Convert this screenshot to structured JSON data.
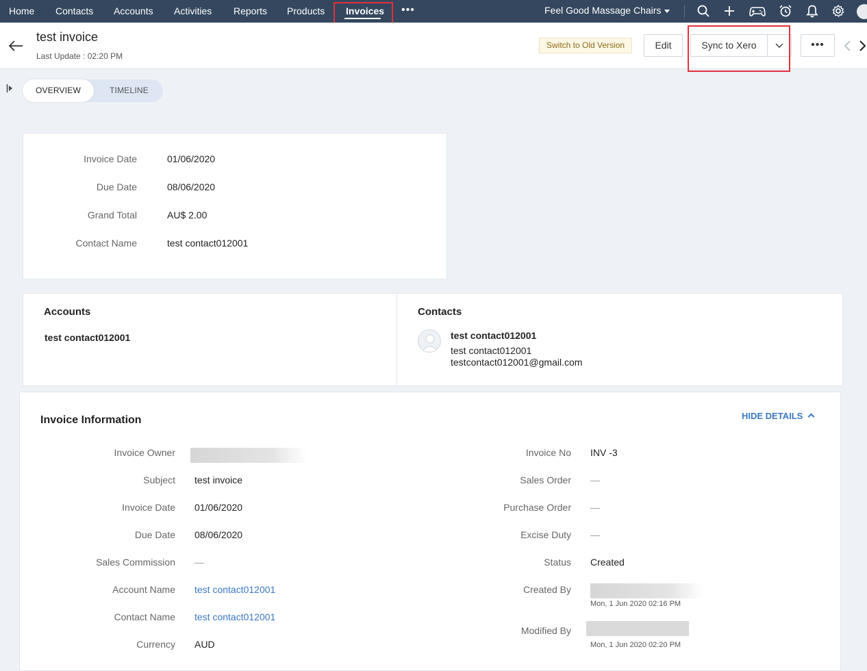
{
  "nav": {
    "items": [
      "Home",
      "Contacts",
      "Accounts",
      "Activities",
      "Reports",
      "Products",
      "Invoices"
    ],
    "active": "Invoices",
    "more": "•••",
    "org_name": "Feel Good Massage Chairs",
    "icons": [
      "search-icon",
      "plus-icon",
      "gamepad-icon",
      "alarm-icon",
      "bell-icon",
      "gear-icon",
      "avatar"
    ]
  },
  "header": {
    "title": "test invoice",
    "subtitle": "Last Update : 02:20 PM",
    "old_version": "Switch to Old Version",
    "edit": "Edit",
    "sync": "Sync to Xero",
    "more": "•••"
  },
  "tabs": [
    "OVERVIEW",
    "TIMELINE"
  ],
  "summary": {
    "rows": [
      {
        "label": "Invoice Date",
        "value": "01/06/2020"
      },
      {
        "label": "Due Date",
        "value": "08/06/2020"
      },
      {
        "label": "Grand Total",
        "value": "AU$ 2.00"
      },
      {
        "label": "Contact Name",
        "value": "test contact012001"
      }
    ]
  },
  "related": {
    "accounts_title": "Accounts",
    "account_name": "test contact012001",
    "contacts_title": "Contacts",
    "contact_name": "test contact012001",
    "contact_account": "test contact012001",
    "contact_email": "testcontact012001@gmail.com"
  },
  "info": {
    "title": "Invoice Information",
    "hide": "HIDE DETAILS",
    "left": [
      {
        "label": "Invoice Owner",
        "value": ""
      },
      {
        "label": "Subject",
        "value": "test invoice"
      },
      {
        "label": "Invoice Date",
        "value": "01/06/2020"
      },
      {
        "label": "Due Date",
        "value": "08/06/2020"
      },
      {
        "label": "Sales Commission",
        "value": "—"
      },
      {
        "label": "Account Name",
        "value": "test contact012001"
      },
      {
        "label": "Contact Name",
        "value": "test contact012001"
      },
      {
        "label": "Currency",
        "value": "AUD"
      }
    ],
    "right": [
      {
        "label": "Invoice No",
        "value": "INV -3"
      },
      {
        "label": "Sales Order",
        "value": "—"
      },
      {
        "label": "Purchase Order",
        "value": "—"
      },
      {
        "label": "Excise Duty",
        "value": "—"
      },
      {
        "label": "Status",
        "value": "Created"
      },
      {
        "label": "Created By",
        "value": "",
        "meta": "Mon, 1 Jun 2020 02:16 PM"
      },
      {
        "label": "Modified By",
        "value": "",
        "meta": "Mon, 1 Jun 2020 02:20 PM"
      }
    ]
  },
  "colors": {
    "nav_bg": "#34475f",
    "link": "#3a78c2",
    "highlight": "#e2313b"
  }
}
